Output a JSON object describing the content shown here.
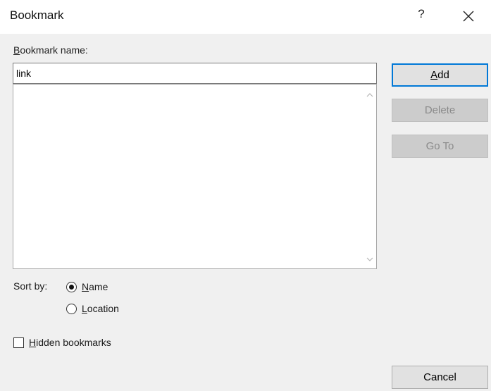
{
  "dialog": {
    "title": "Bookmark",
    "help_label": "?"
  },
  "bookmark_name": {
    "label_mnemonic": "B",
    "label_rest": "ookmark name:",
    "value": "link"
  },
  "bookmark_list": {
    "items": []
  },
  "buttons": {
    "add_mnemonic": "A",
    "add_rest": "dd",
    "delete": "Delete",
    "goto": "Go To",
    "cancel": "Cancel"
  },
  "sort": {
    "label": "Sort by:",
    "name_mnemonic": "N",
    "name_rest": "ame",
    "location_mnemonic": "L",
    "location_rest": "ocation",
    "selected": "Name"
  },
  "hidden": {
    "mnemonic": "H",
    "rest": "idden bookmarks",
    "checked": false
  },
  "colors": {
    "dialog_bg": "#f0f0f0",
    "titlebar_bg": "#ffffff",
    "default_button_border": "#0078d7",
    "disabled_button_bg": "#cccccc",
    "disabled_text": "#8a8a8a"
  },
  "icons": {
    "close": "close-icon",
    "scroll_up": "chevron-up-icon",
    "scroll_down": "chevron-down-icon"
  }
}
